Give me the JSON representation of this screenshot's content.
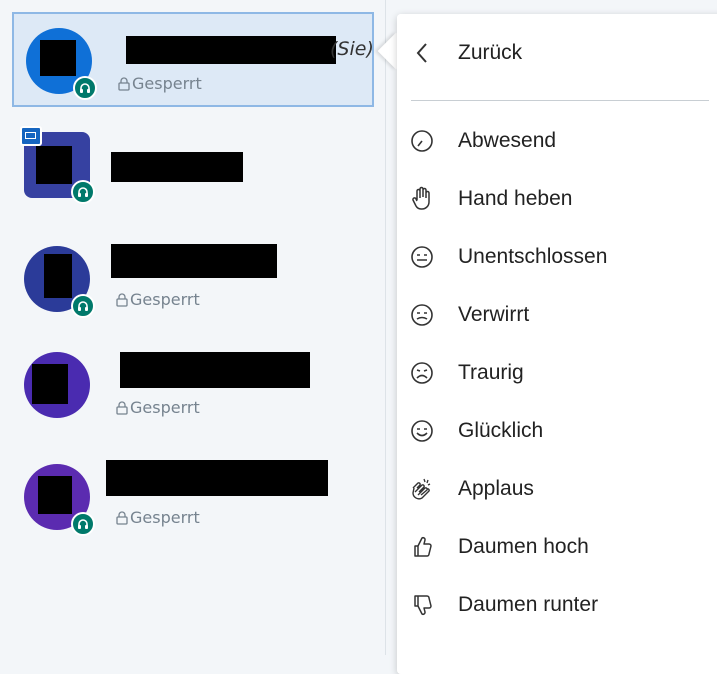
{
  "users": [
    {
      "you_label": "(Sie)",
      "status": "Gesperrt",
      "avatar_color": "#0f70d7",
      "selected": true
    },
    {
      "status": "",
      "avatar_color": "#3641a1",
      "presenter": true
    },
    {
      "status": "Gesperrt",
      "avatar_color": "#2b3b99"
    },
    {
      "status": "Gesperrt",
      "avatar_color": "#4a2bb0"
    },
    {
      "status": "Gesperrt",
      "avatar_color": "#5b2bb0"
    }
  ],
  "menu": {
    "back_label": "Zurück",
    "items": [
      {
        "label": "Abwesend",
        "icon": "clock-icon"
      },
      {
        "label": "Hand heben",
        "icon": "hand-icon"
      },
      {
        "label": "Unentschlossen",
        "icon": "neutral-face-icon"
      },
      {
        "label": "Verwirrt",
        "icon": "confused-face-icon"
      },
      {
        "label": "Traurig",
        "icon": "sad-face-icon"
      },
      {
        "label": "Glücklich",
        "icon": "happy-face-icon"
      },
      {
        "label": "Applaus",
        "icon": "applause-icon"
      },
      {
        "label": "Daumen hoch",
        "icon": "thumbs-up-icon"
      },
      {
        "label": "Daumen runter",
        "icon": "thumbs-down-icon"
      }
    ]
  },
  "colors": {
    "audio_badge": "#00796b",
    "selected_bg": "#dde9f6",
    "selected_border": "#8eb8e5"
  }
}
